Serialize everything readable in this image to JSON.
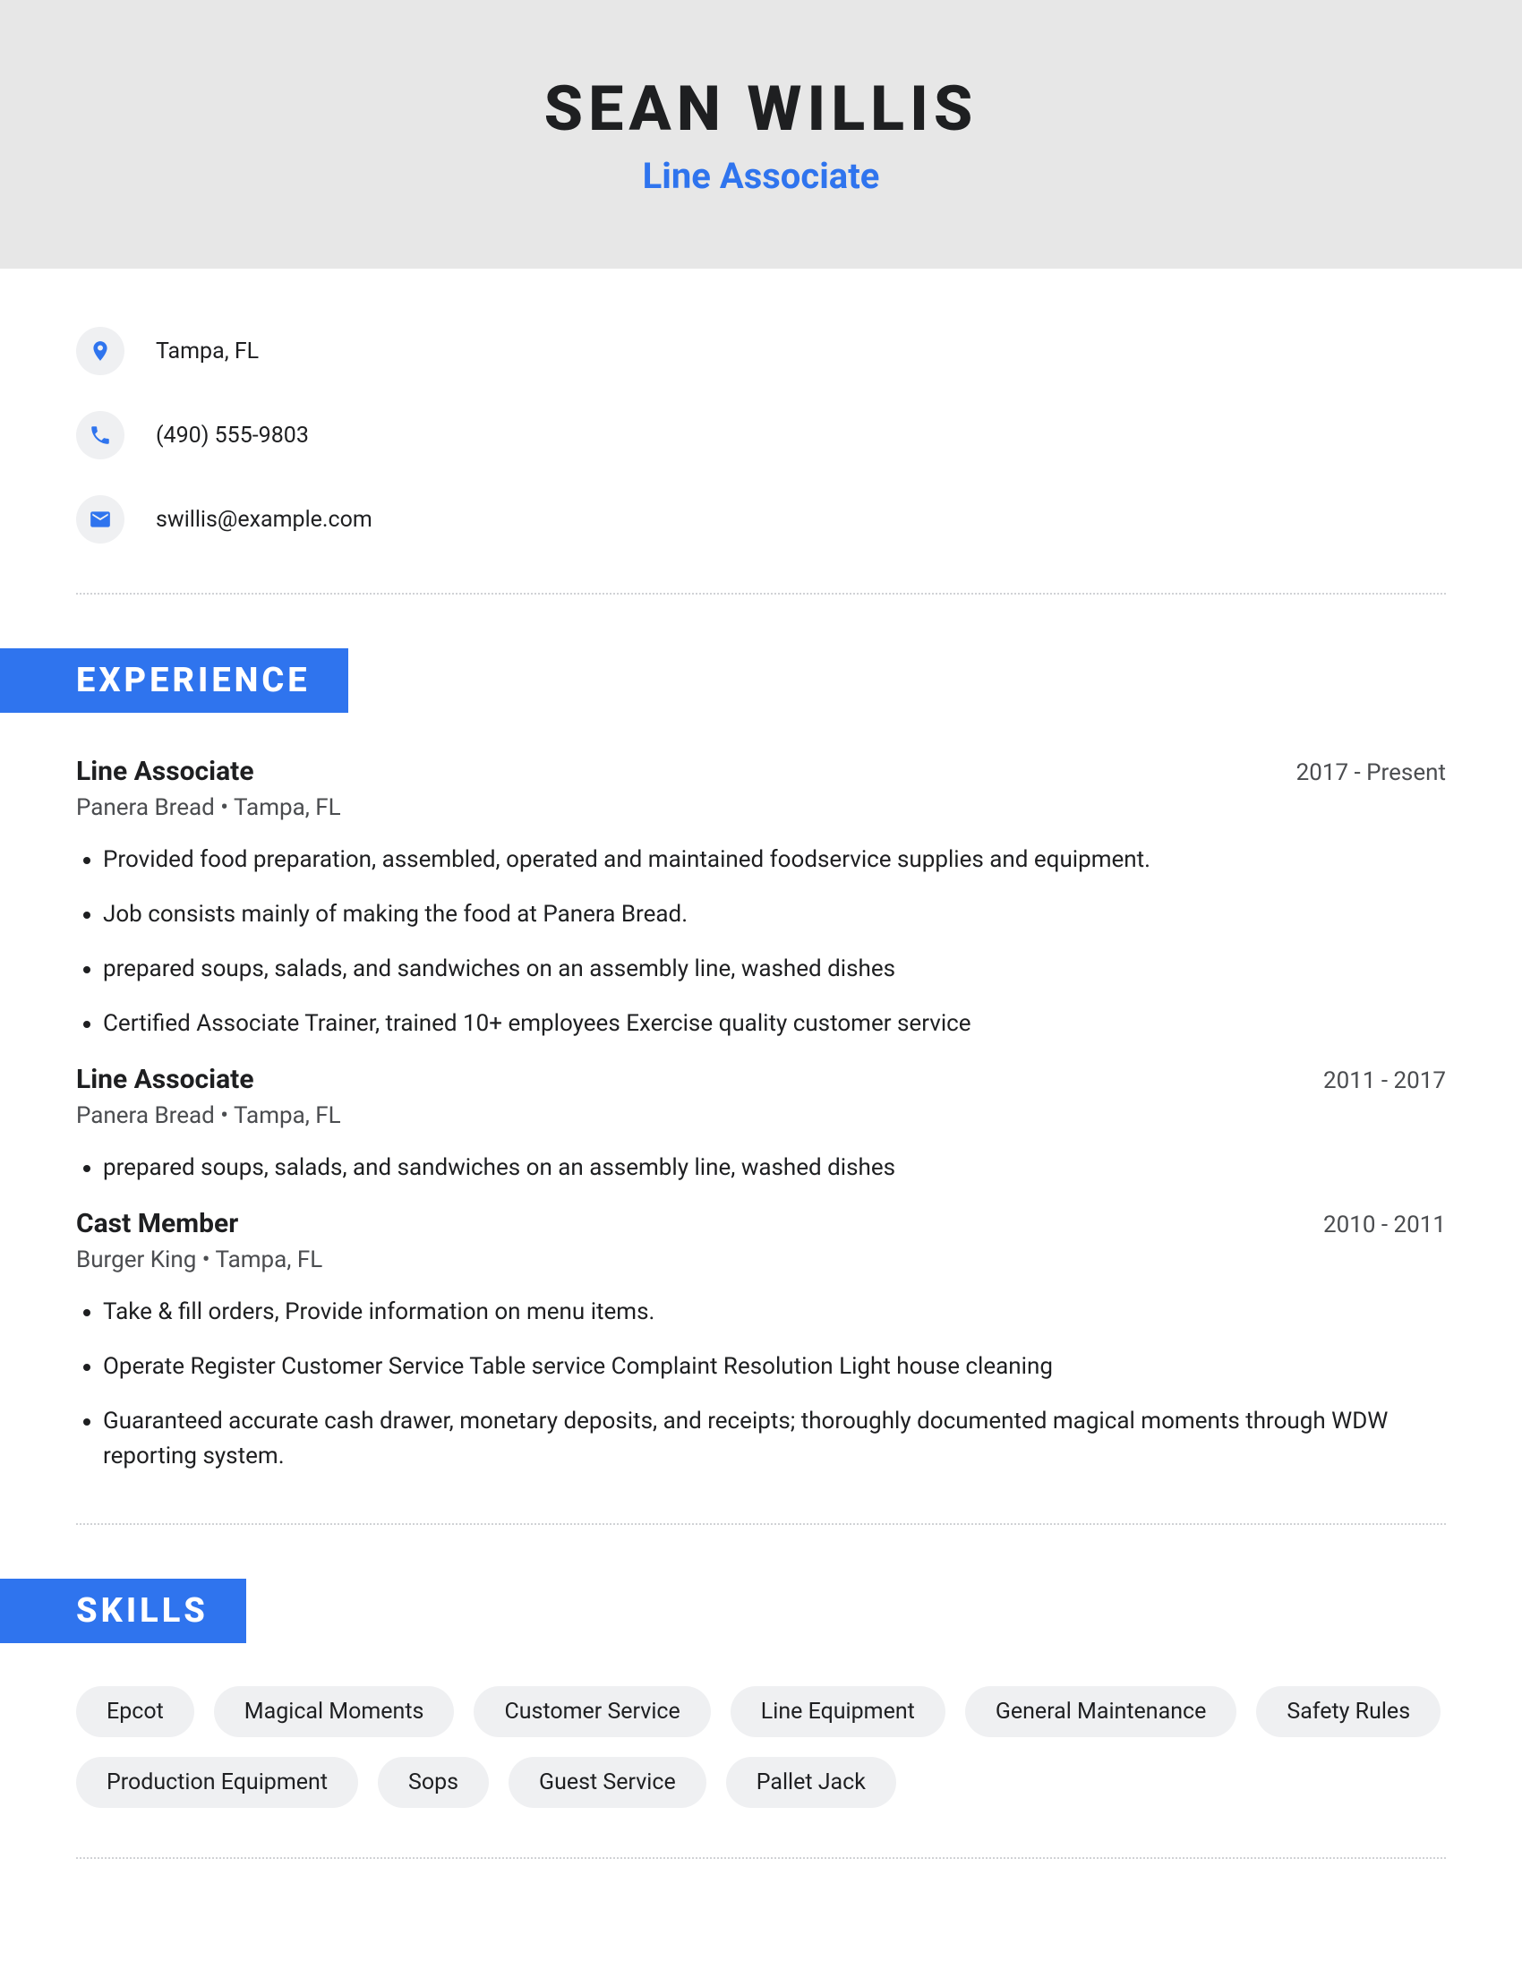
{
  "header": {
    "name": "SEAN WILLIS",
    "title": "Line Associate"
  },
  "contact": {
    "location": "Tampa, FL",
    "phone": "(490) 555-9803",
    "email": "swillis@example.com"
  },
  "sections": {
    "experience_label": "EXPERIENCE",
    "skills_label": "SKILLS"
  },
  "experience": [
    {
      "title": "Line Associate",
      "dates": "2017 - Present",
      "company": "Panera Bread",
      "location": "Tampa, FL",
      "bullets": [
        "Provided food preparation, assembled, operated and maintained foodservice supplies and equipment.",
        "Job consists mainly of making the food at Panera Bread.",
        "prepared soups, salads, and sandwiches on an assembly line, washed dishes",
        "Certified Associate Trainer, trained 10+ employees Exercise quality customer service"
      ]
    },
    {
      "title": "Line Associate",
      "dates": "2011 - 2017",
      "company": "Panera Bread",
      "location": "Tampa, FL",
      "bullets": [
        "prepared soups, salads, and sandwiches on an assembly line, washed dishes"
      ]
    },
    {
      "title": "Cast Member",
      "dates": "2010 - 2011",
      "company": "Burger King",
      "location": "Tampa, FL",
      "bullets": [
        "Take & fill orders, Provide information on menu items.",
        "Operate Register Customer Service Table service Complaint Resolution Light house cleaning",
        "Guaranteed accurate cash drawer, monetary deposits, and receipts; thoroughly documented magical moments through WDW reporting system."
      ]
    }
  ],
  "skills": [
    "Epcot",
    "Magical Moments",
    "Customer Service",
    "Line Equipment",
    "General Maintenance",
    "Safety Rules",
    "Production Equipment",
    "Sops",
    "Guest Service",
    "Pallet Jack"
  ]
}
